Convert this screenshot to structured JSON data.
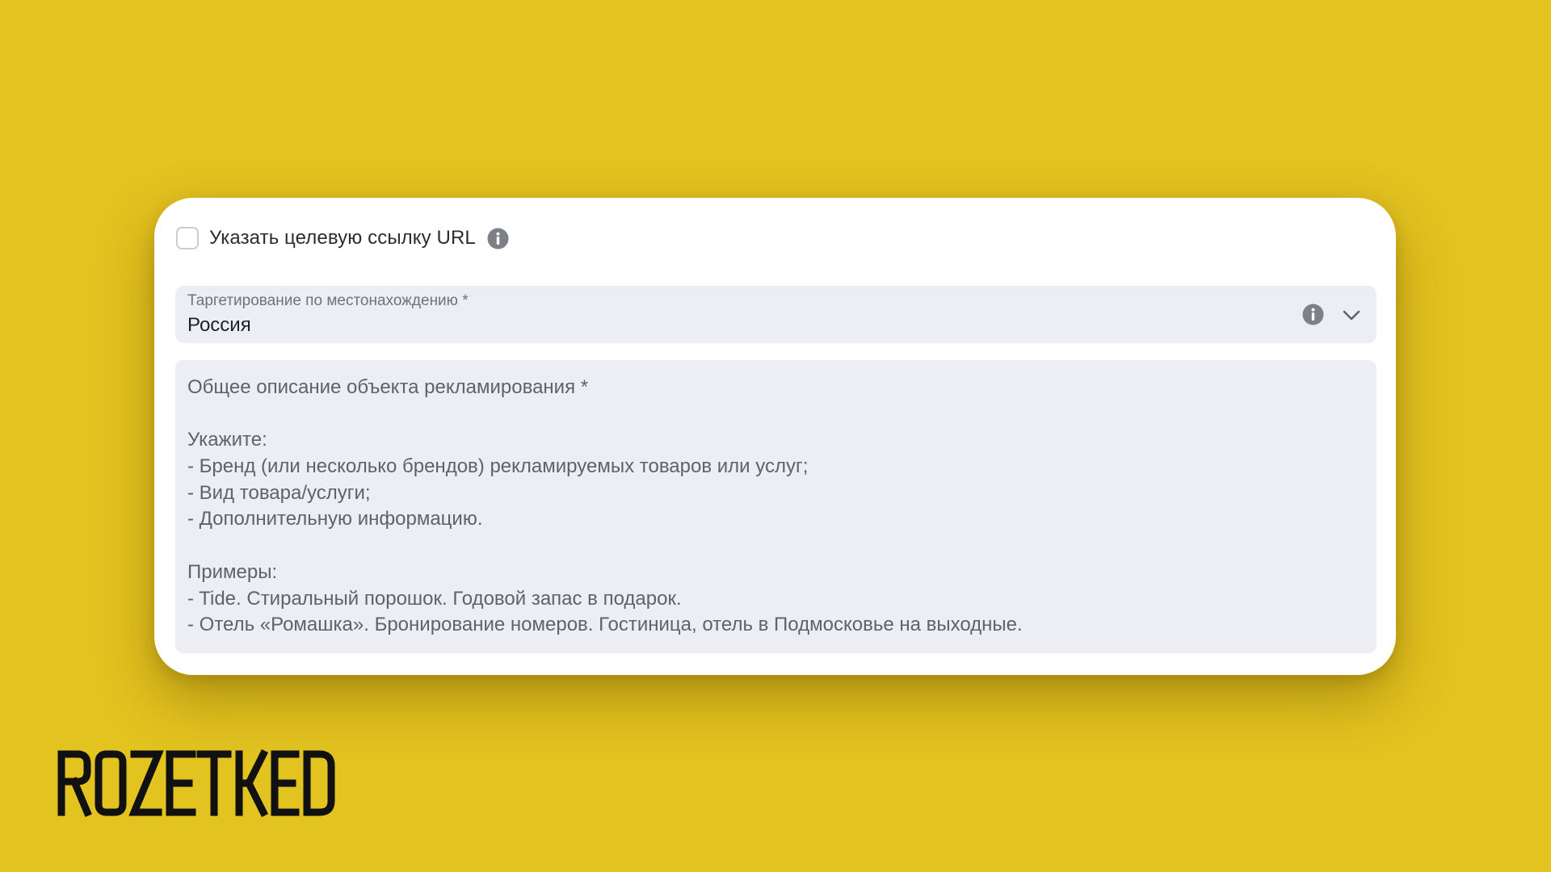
{
  "form": {
    "url_checkbox": {
      "checked": false,
      "label": "Указать целевую ссылку URL",
      "info_icon": "info-icon"
    },
    "location_select": {
      "label": "Таргетирование по местонахождению *",
      "value": "Россия",
      "info_icon": "info-icon",
      "dropdown_icon": "chevron-down-icon"
    },
    "description_textarea": {
      "placeholder_lines": [
        "Общее описание объекта рекламирования *",
        "",
        "Укажите:",
        "- Бренд (или несколько брендов) рекламируемых товаров или услуг;",
        "- Вид товара/услуги;",
        "- Дополнительную информацию.",
        "",
        "Примеры:",
        "- Tide. Стиральный порошок. Годовой запас в подарок.",
        "- Отель «Ромашка». Бронирование номеров. Гостиница, отель в Подмосковье на выходные."
      ]
    }
  },
  "watermark": {
    "logo_text": "ROZETKED"
  },
  "colors": {
    "background": "#e3c31f",
    "card": "#ffffff",
    "field": "#eceef3",
    "icon": "#7c8087",
    "logo": "#111111"
  }
}
